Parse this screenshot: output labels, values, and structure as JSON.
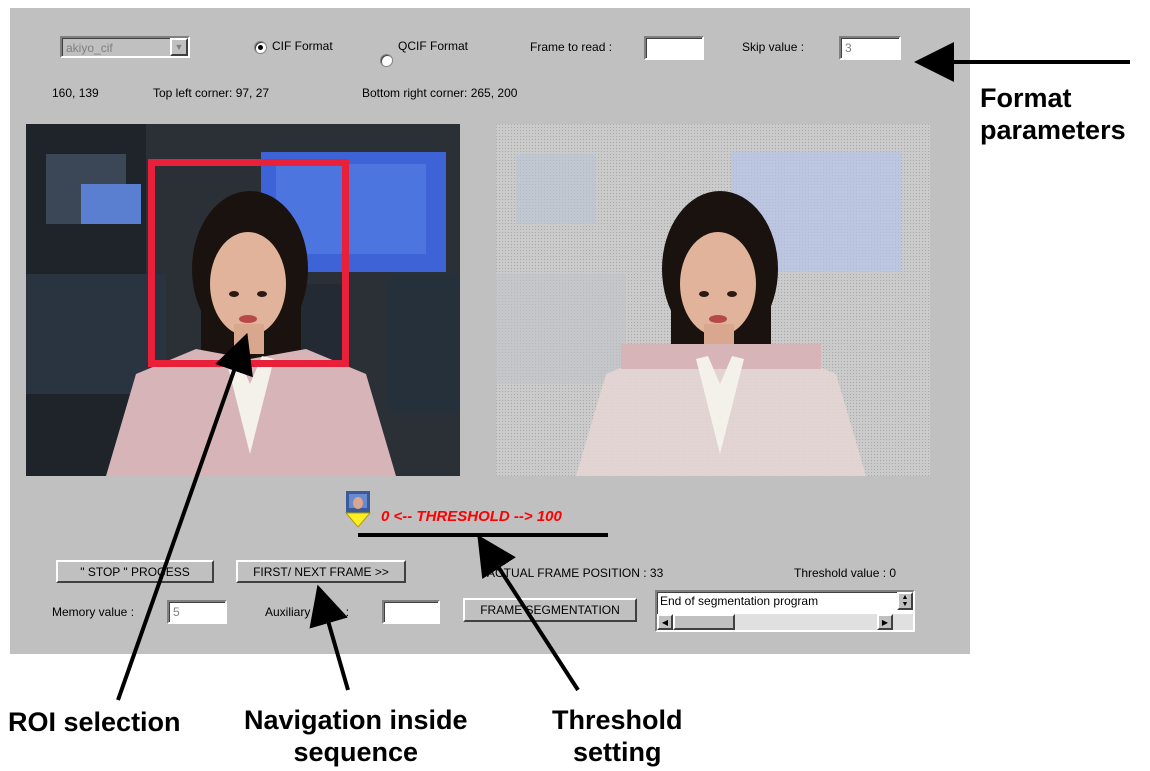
{
  "format": {
    "sequence_select": "akiyo_cif",
    "cif_label": "CIF  Format",
    "qcif_label": "QCIF  Format",
    "frame_to_read_label": "Frame to read :",
    "frame_to_read_value": "",
    "skip_label": "Skip value :",
    "skip_value": "3"
  },
  "coords": {
    "cursor": "160, 139",
    "top_left": "Top left corner: 97, 27",
    "bottom_right": "Bottom right corner: 265, 200"
  },
  "threshold": {
    "label": "0 <-- THRESHOLD --> 100",
    "value_text": "Threshold value : 0"
  },
  "controls": {
    "stop_button": "\" STOP \"  PROCESS",
    "next_frame_button": "FIRST/ NEXT FRAME >>",
    "actual_frame": "ACTUAL  FRAME  POSITION : 33",
    "memory_label": "Memory value :",
    "memory_value": "5",
    "auxiliary_label": "Auxiliary value :",
    "auxiliary_value": "",
    "segmentation_button": "FRAME SEGMENTATION",
    "log_text": "End of segmentation program"
  },
  "callouts": {
    "format_parameters": [
      "Format",
      "parameters"
    ],
    "roi_selection": "ROI selection",
    "navigation": [
      "Navigation inside",
      "sequence"
    ],
    "threshold_setting": [
      "Threshold",
      "setting"
    ]
  },
  "colors": {
    "roi_box": "#e8203a",
    "threshold_text": "#ff0000",
    "window_bg": "#c0c0c0"
  }
}
